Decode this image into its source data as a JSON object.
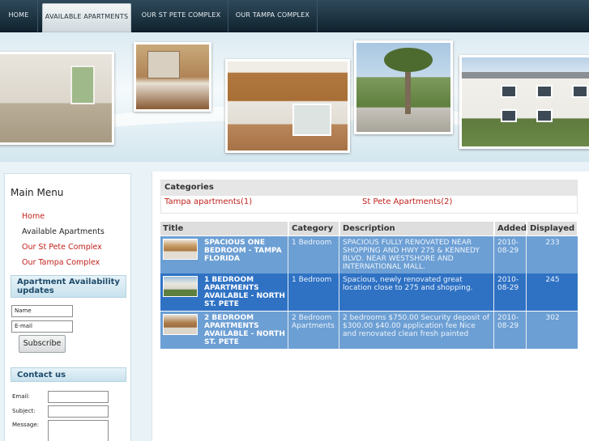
{
  "nav": {
    "items": [
      {
        "label": "HOME"
      },
      {
        "label": "AVAILABLE APARTMENTS"
      },
      {
        "label": "OUR ST PETE COMPLEX"
      },
      {
        "label": "OUR TAMPA COMPLEX"
      }
    ],
    "active": "AVAILABLE APARTMENTS"
  },
  "sidebar": {
    "main_menu_title": "Main Menu",
    "menu": [
      {
        "label": "Home"
      },
      {
        "label": "Available Apartments"
      },
      {
        "label": "Our St Pete Complex"
      },
      {
        "label": "Our Tampa Complex"
      }
    ],
    "availability_title": "Apartment Availability updates",
    "name_value": "Name",
    "email_value": "E-mail",
    "subscribe_label": "Subscribe",
    "contact_title": "Contact us",
    "contact_labels": {
      "email": "Email:",
      "subject": "Subject:",
      "message": "Message:"
    }
  },
  "categories": {
    "title": "Categories",
    "items": [
      {
        "label": "Tampa apartments(1)"
      },
      {
        "label": "St Pete Apartments(2)"
      }
    ]
  },
  "listing": {
    "headers": {
      "title": "Title",
      "category": "Category",
      "description": "Description",
      "added": "Added",
      "displayed": "Displayed"
    },
    "rows": [
      {
        "title": "SPACIOUS ONE BEDROOM - TAMPA FLORIDA",
        "category": "1 Bedroom",
        "description": "SPACIOUS FULLY RENOVATED NEAR SHOPPING AND HWY 275 & KENNEDY BLVD. NEAR WESTSHORE AND INTERNATIONAL MALL.",
        "added": "2010-08-29",
        "displayed": "233"
      },
      {
        "title": "1 BEDROOM APARTMENTS AVAILABLE - NORTH ST. PETE",
        "category": "1 Bedroom",
        "description": "Spacious, newly renovated great location close to 275 and shopping.",
        "added": "2010-08-29",
        "displayed": "245"
      },
      {
        "title": "2 BEDROOM APARTMENTS AVAILABLE - NORTH ST. PETE",
        "category": "2 Bedroom Apartments",
        "description": "2 bedrooms $750.00 Security deposit of $300.00 $40.00 application fee Nice and renovated clean fresh painted",
        "added": "2010-08-29",
        "displayed": "302"
      }
    ]
  },
  "colors": {
    "nav_bg": "#1a2e3b",
    "link_red": "#c0221c",
    "row_light": "#6c9fd4",
    "row_dark": "#2f72c4"
  }
}
